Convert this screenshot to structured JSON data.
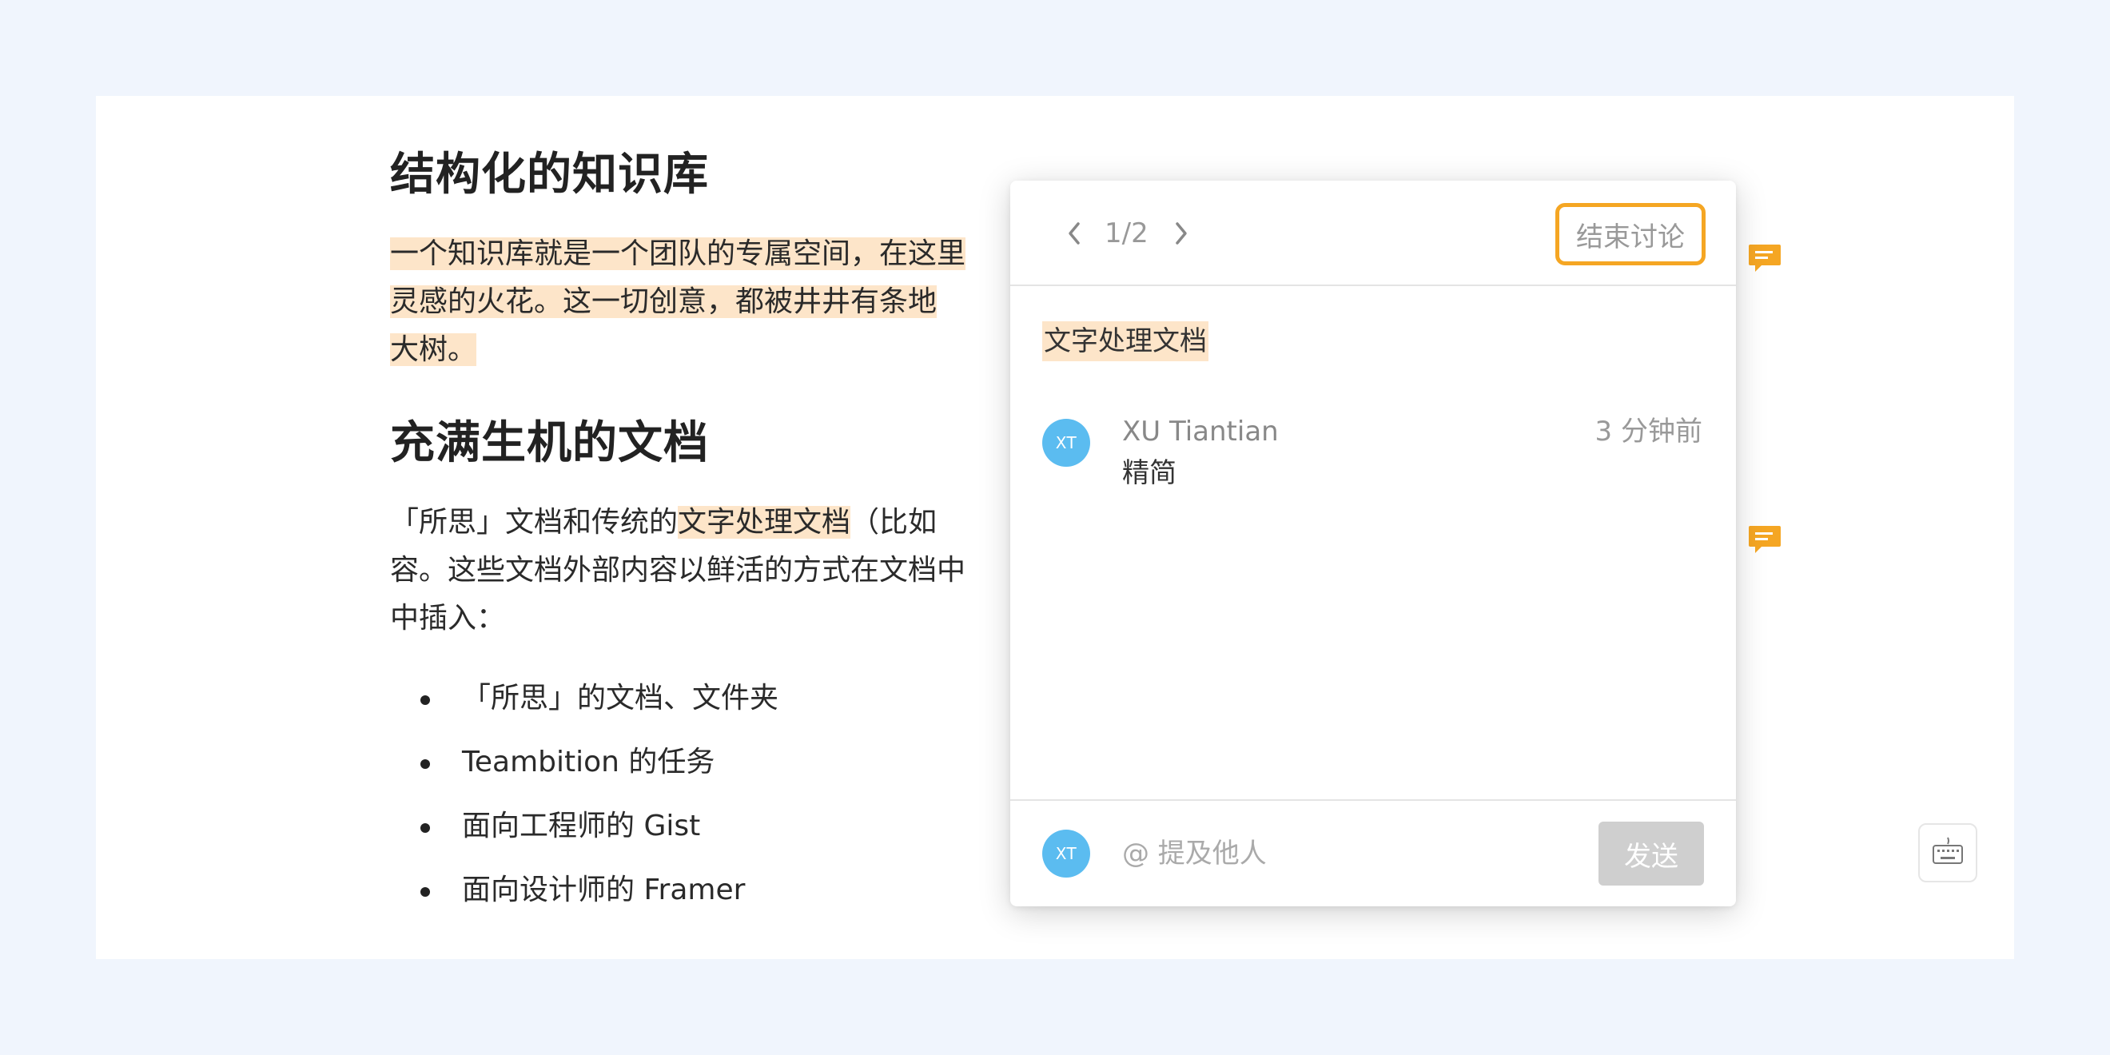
{
  "document": {
    "heading1": "结构化的知识库",
    "para1_highlighted": "一个知识库就是一个团队的专属空间，在这里",
    "para1_line2": "灵感的火花。这一切创意，都被井井有条地",
    "para1_line3": "大树。",
    "heading2": "充满生机的文档",
    "para2_prefix": "「所思」文档和传统的",
    "para2_highlight": "文字处理文档",
    "para2_suffix": "（比如 ",
    "para2_line2": "容。这些文档外部内容以鲜活的方式在文档中",
    "para2_line3": "中插入：",
    "bullets": [
      "「所思」的文档、文件夹",
      "Teambition 的任务",
      "面向工程师的 Gist",
      "面向设计师的 Framer"
    ]
  },
  "comment_panel": {
    "pager": "1/2",
    "end_discussion_label": "结束讨论",
    "quote": "文字处理文档",
    "comment": {
      "avatar_initials": "XT",
      "author": "XU Tiantian",
      "time": "3 分钟前",
      "text": "精简"
    },
    "footer": {
      "avatar_initials": "XT",
      "input_placeholder": "@ 提及他人",
      "send_label": "发送"
    }
  },
  "icons": {
    "prev": "chevron-left-icon",
    "next": "chevron-right-icon",
    "comment_marker": "comment-bubble-icon",
    "keyboard": "keyboard-icon"
  },
  "colors": {
    "highlight": "#fde5c9",
    "accent_orange": "#f5a623",
    "avatar_blue": "#5bbcf0",
    "page_bg": "#f0f5fd"
  }
}
